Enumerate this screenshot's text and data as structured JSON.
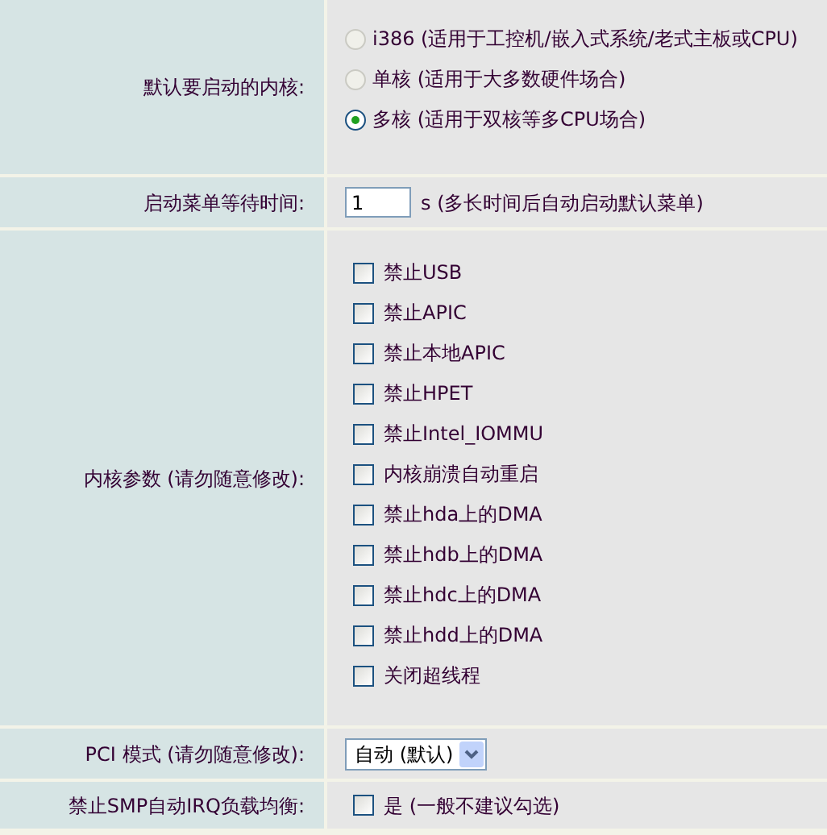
{
  "rows": [
    {
      "kind": "radio_group",
      "label": "默认要启动的内核:",
      "options": [
        {
          "text": "i386 (适用于工控机/嵌入式系统/老式主板或CPU)",
          "selected": false,
          "disabled": true
        },
        {
          "text": "单核 (适用于大多数硬件场合)",
          "selected": false,
          "disabled": true
        },
        {
          "text": "多核 (适用于双核等多CPU场合)",
          "selected": true,
          "disabled": false
        }
      ]
    },
    {
      "kind": "number_input",
      "label": "启动菜单等待时间:",
      "value": "1",
      "suffix": "s (多长时间后自动启动默认菜单)"
    },
    {
      "kind": "checkbox_list",
      "label": "内核参数 (请勿随意修改):",
      "options": [
        {
          "text": "禁止USB",
          "checked": false
        },
        {
          "text": "禁止APIC",
          "checked": false
        },
        {
          "text": "禁止本地APIC",
          "checked": false
        },
        {
          "text": "禁止HPET",
          "checked": false
        },
        {
          "text": "禁止Intel_IOMMU",
          "checked": false
        },
        {
          "text": "内核崩溃自动重启",
          "checked": false
        },
        {
          "text": "禁止hda上的DMA",
          "checked": false
        },
        {
          "text": "禁止hdb上的DMA",
          "checked": false
        },
        {
          "text": "禁止hdc上的DMA",
          "checked": false
        },
        {
          "text": "禁止hdd上的DMA",
          "checked": false
        },
        {
          "text": "关闭超线程",
          "checked": false
        }
      ]
    },
    {
      "kind": "select",
      "label": "PCI 模式 (请勿随意修改):",
      "value": "自动 (默认)"
    },
    {
      "kind": "checkbox",
      "label": "禁止SMP自动IRQ负载均衡:",
      "text": "是 (一般不建议勾选)",
      "checked": false
    }
  ]
}
